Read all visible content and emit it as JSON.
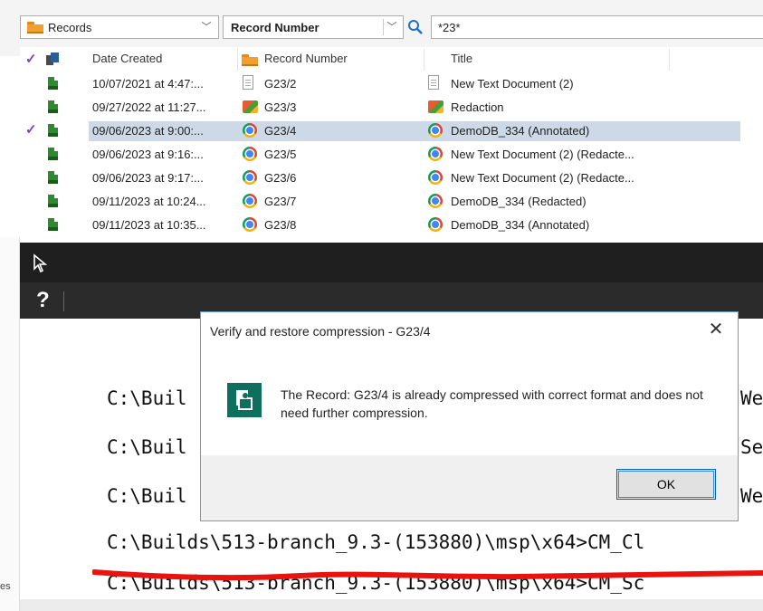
{
  "search": {
    "scope": "Records",
    "field": "Record Number",
    "query": "*23*"
  },
  "grid": {
    "columns": [
      "Date Created",
      "Record Number",
      "Title"
    ],
    "rows": [
      {
        "checked": false,
        "date": "10/07/2021 at 4:47:...",
        "number": "G23/2",
        "title": "New Text Document (2)",
        "num_icon": "text-document-icon",
        "title_icon": "text-document-icon",
        "selected": false
      },
      {
        "checked": false,
        "date": "09/27/2022 at 11:27...",
        "number": "G23/3",
        "title": "Redaction",
        "num_icon": "redaction-image-icon",
        "title_icon": "redaction-image-icon",
        "selected": false
      },
      {
        "checked": true,
        "date": "09/06/2023 at 9:00:...",
        "number": "G23/4",
        "title": "DemoDB_334 (Annotated)",
        "num_icon": "chrome-icon",
        "title_icon": "chrome-icon",
        "selected": true
      },
      {
        "checked": false,
        "date": "09/06/2023 at 9:16:...",
        "number": "G23/5",
        "title": "New Text Document (2) (Redacte...",
        "num_icon": "chrome-icon",
        "title_icon": "chrome-icon",
        "selected": false
      },
      {
        "checked": false,
        "date": "09/06/2023 at 9:17:...",
        "number": "G23/6",
        "title": "New Text Document (2) (Redacte...",
        "num_icon": "chrome-icon",
        "title_icon": "chrome-icon",
        "selected": false
      },
      {
        "checked": false,
        "date": "09/11/2023 at 10:24...",
        "number": "G23/7",
        "title": "DemoDB_334 (Redacted)",
        "num_icon": "chrome-icon",
        "title_icon": "chrome-icon",
        "selected": false
      },
      {
        "checked": false,
        "date": "09/11/2023 at 10:35...",
        "number": "G23/8",
        "title": "DemoDB_334 (Annotated)",
        "num_icon": "chrome-icon",
        "title_icon": "chrome-icon",
        "selected": false
      }
    ]
  },
  "console": {
    "help_glyph": "?",
    "lines": [
      "C:\\Buil",
      "C:\\Buil",
      "C:\\Buil",
      "C:\\Builds\\513-branch_9.3-(153880)\\msp\\x64>CM_Cl",
      "C:\\Builds\\513-branch_9.3-(153880)\\msp\\x64>CM_Sc"
    ],
    "right_fragments": [
      "We",
      "Se",
      "We"
    ]
  },
  "dialog": {
    "title": "Verify and restore compression - G23/4",
    "message": "The Record: G23/4 is already compressed with correct format and does not need further compression.",
    "ok_label": "OK",
    "close_glyph": "✕"
  },
  "left_edge_text": "es",
  "colors": {
    "selection": "#cdd9e6",
    "check": "#7a3fc9",
    "console_bar": "#1f1f1f",
    "dialog_icon": "#0e6f5f",
    "ok_border": "#0a5fc2",
    "strike": "#e8130f"
  }
}
